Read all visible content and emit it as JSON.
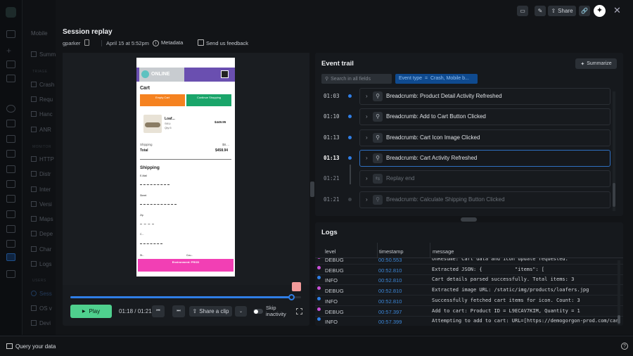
{
  "sidebar": {
    "section_title": "Mobile",
    "items": [
      {
        "label": "Summ"
      },
      {
        "label": "Crash"
      },
      {
        "label": "Requ"
      },
      {
        "label": "Hanc"
      },
      {
        "label": "ANR"
      },
      {
        "label": "HTTP"
      },
      {
        "label": "Distr"
      },
      {
        "label": "Inter"
      },
      {
        "label": "Versi"
      },
      {
        "label": "Maps"
      },
      {
        "label": "Depe"
      },
      {
        "label": "Char"
      },
      {
        "label": "Logs"
      },
      {
        "label": "Sess"
      },
      {
        "label": "OS v"
      },
      {
        "label": "Devi"
      }
    ],
    "sections": [
      "TRIAGE",
      "MONITOR",
      "USERS"
    ]
  },
  "topbar": {
    "share_label": "Share",
    "icons": [
      "comment-icon",
      "edit-note-icon",
      "share-icon",
      "link-icon",
      "ai-assistant-icon",
      "close-icon"
    ]
  },
  "header": {
    "title": "Session replay",
    "user": "gparker",
    "date": "April 15 at 5:52pm",
    "metadata_label": "Metadata",
    "feedback_label": "Send us feedback"
  },
  "phone": {
    "logo": "ONLINE",
    "page_title": "Cart",
    "empty_cart": "Empty Cart",
    "continue_shopping": "Continue Shopping",
    "item_name": "Loaf...",
    "item_sku": "SKU:",
    "item_qty": "Qty:5",
    "item_price": "$449.95",
    "shipping_label": "Shipping",
    "shipping_value": "$8....",
    "total_label": "Total",
    "total_value": "$458.94",
    "shipping_heading": "Shipping",
    "field_email": "E-Mail",
    "field_street": "Street",
    "field_zip": "Zip",
    "field_c": "C...",
    "field_st": "St...",
    "field_country": "Cou...",
    "env_banner": "Environment: PROD"
  },
  "player": {
    "progress": 0.96,
    "play_label": "Play",
    "time": "01:18 / 01:21",
    "share_clip_label": "Share a clip",
    "skip_label": "Skip inactivity",
    "skip_enabled": false
  },
  "event_trail": {
    "title": "Event trail",
    "summarize_label": "Summarize",
    "search_placeholder": "Search in all fields",
    "filter_label": "Event type  =  Crash, Mobile b...",
    "events": [
      {
        "time": "01:03",
        "label": "Breadcrumb: Product Detail Activity Refreshed"
      },
      {
        "time": "01:10",
        "label": "Breadcrumb: Add to Cart Button Clicked"
      },
      {
        "time": "01:13",
        "label": "Breadcrumb: Cart Icon Image Clicked"
      },
      {
        "time": "01:13",
        "label": "Breadcrumb: Cart Activity Refreshed",
        "selected": true
      },
      {
        "time": "01:21",
        "label": "Replay end",
        "future": true
      },
      {
        "time": "01:21",
        "label": "Breadcrumb: Calculate Shipping Button Clicked",
        "future": true
      }
    ]
  },
  "logs": {
    "title": "Logs",
    "columns": [
      "level",
      "timestamp",
      "message"
    ],
    "rows": [
      {
        "level": "DEBUG",
        "timestamp": "00:50.553",
        "message": "onResume: Cart data and icon update requested."
      },
      {
        "level": "DEBUG",
        "timestamp": "00:52.810",
        "message": "Extracted JSON: {           \"items\": ["
      },
      {
        "level": "INFO",
        "timestamp": "00:52.810",
        "message": "Cart details parsed successfully. Total items: 3"
      },
      {
        "level": "DEBUG",
        "timestamp": "00:52.810",
        "message": "Extracted image URL: /static/img/products/loafers.jpg"
      },
      {
        "level": "INFO",
        "timestamp": "00:52.810",
        "message": "Successfully fetched cart items for icon. Count: 3"
      },
      {
        "level": "DEBUG",
        "timestamp": "00:57.397",
        "message": "Add to cart: Product ID = L9ECAV7KIM, Quantity = 1"
      },
      {
        "level": "INFO",
        "timestamp": "00:57.399",
        "message": "Attempting to add to cart: URL=[https://demogorgon-prod.com/cart"
      }
    ]
  },
  "colors": {
    "debug": "#c850d8",
    "info": "#2f7ee6",
    "accent": "#2f7ee6",
    "play": "#4fd08e"
  },
  "bottom": {
    "query_label": "Query your data"
  }
}
